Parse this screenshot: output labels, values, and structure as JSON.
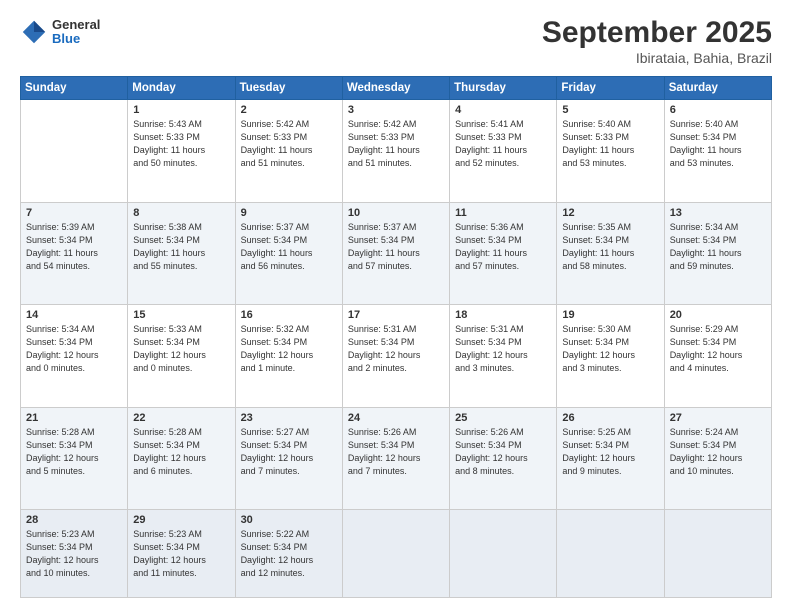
{
  "header": {
    "logo_line1": "General",
    "logo_line2": "Blue",
    "title": "September 2025",
    "subtitle": "Ibirataia, Bahia, Brazil"
  },
  "days_of_week": [
    "Sunday",
    "Monday",
    "Tuesday",
    "Wednesday",
    "Thursday",
    "Friday",
    "Saturday"
  ],
  "weeks": [
    [
      {
        "day": "",
        "info": ""
      },
      {
        "day": "1",
        "info": "Sunrise: 5:43 AM\nSunset: 5:33 PM\nDaylight: 11 hours\nand 50 minutes."
      },
      {
        "day": "2",
        "info": "Sunrise: 5:42 AM\nSunset: 5:33 PM\nDaylight: 11 hours\nand 51 minutes."
      },
      {
        "day": "3",
        "info": "Sunrise: 5:42 AM\nSunset: 5:33 PM\nDaylight: 11 hours\nand 51 minutes."
      },
      {
        "day": "4",
        "info": "Sunrise: 5:41 AM\nSunset: 5:33 PM\nDaylight: 11 hours\nand 52 minutes."
      },
      {
        "day": "5",
        "info": "Sunrise: 5:40 AM\nSunset: 5:33 PM\nDaylight: 11 hours\nand 53 minutes."
      },
      {
        "day": "6",
        "info": "Sunrise: 5:40 AM\nSunset: 5:34 PM\nDaylight: 11 hours\nand 53 minutes."
      }
    ],
    [
      {
        "day": "7",
        "info": "Sunrise: 5:39 AM\nSunset: 5:34 PM\nDaylight: 11 hours\nand 54 minutes."
      },
      {
        "day": "8",
        "info": "Sunrise: 5:38 AM\nSunset: 5:34 PM\nDaylight: 11 hours\nand 55 minutes."
      },
      {
        "day": "9",
        "info": "Sunrise: 5:37 AM\nSunset: 5:34 PM\nDaylight: 11 hours\nand 56 minutes."
      },
      {
        "day": "10",
        "info": "Sunrise: 5:37 AM\nSunset: 5:34 PM\nDaylight: 11 hours\nand 57 minutes."
      },
      {
        "day": "11",
        "info": "Sunrise: 5:36 AM\nSunset: 5:34 PM\nDaylight: 11 hours\nand 57 minutes."
      },
      {
        "day": "12",
        "info": "Sunrise: 5:35 AM\nSunset: 5:34 PM\nDaylight: 11 hours\nand 58 minutes."
      },
      {
        "day": "13",
        "info": "Sunrise: 5:34 AM\nSunset: 5:34 PM\nDaylight: 11 hours\nand 59 minutes."
      }
    ],
    [
      {
        "day": "14",
        "info": "Sunrise: 5:34 AM\nSunset: 5:34 PM\nDaylight: 12 hours\nand 0 minutes."
      },
      {
        "day": "15",
        "info": "Sunrise: 5:33 AM\nSunset: 5:34 PM\nDaylight: 12 hours\nand 0 minutes."
      },
      {
        "day": "16",
        "info": "Sunrise: 5:32 AM\nSunset: 5:34 PM\nDaylight: 12 hours\nand 1 minute."
      },
      {
        "day": "17",
        "info": "Sunrise: 5:31 AM\nSunset: 5:34 PM\nDaylight: 12 hours\nand 2 minutes."
      },
      {
        "day": "18",
        "info": "Sunrise: 5:31 AM\nSunset: 5:34 PM\nDaylight: 12 hours\nand 3 minutes."
      },
      {
        "day": "19",
        "info": "Sunrise: 5:30 AM\nSunset: 5:34 PM\nDaylight: 12 hours\nand 3 minutes."
      },
      {
        "day": "20",
        "info": "Sunrise: 5:29 AM\nSunset: 5:34 PM\nDaylight: 12 hours\nand 4 minutes."
      }
    ],
    [
      {
        "day": "21",
        "info": "Sunrise: 5:28 AM\nSunset: 5:34 PM\nDaylight: 12 hours\nand 5 minutes."
      },
      {
        "day": "22",
        "info": "Sunrise: 5:28 AM\nSunset: 5:34 PM\nDaylight: 12 hours\nand 6 minutes."
      },
      {
        "day": "23",
        "info": "Sunrise: 5:27 AM\nSunset: 5:34 PM\nDaylight: 12 hours\nand 7 minutes."
      },
      {
        "day": "24",
        "info": "Sunrise: 5:26 AM\nSunset: 5:34 PM\nDaylight: 12 hours\nand 7 minutes."
      },
      {
        "day": "25",
        "info": "Sunrise: 5:26 AM\nSunset: 5:34 PM\nDaylight: 12 hours\nand 8 minutes."
      },
      {
        "day": "26",
        "info": "Sunrise: 5:25 AM\nSunset: 5:34 PM\nDaylight: 12 hours\nand 9 minutes."
      },
      {
        "day": "27",
        "info": "Sunrise: 5:24 AM\nSunset: 5:34 PM\nDaylight: 12 hours\nand 10 minutes."
      }
    ],
    [
      {
        "day": "28",
        "info": "Sunrise: 5:23 AM\nSunset: 5:34 PM\nDaylight: 12 hours\nand 10 minutes."
      },
      {
        "day": "29",
        "info": "Sunrise: 5:23 AM\nSunset: 5:34 PM\nDaylight: 12 hours\nand 11 minutes."
      },
      {
        "day": "30",
        "info": "Sunrise: 5:22 AM\nSunset: 5:34 PM\nDaylight: 12 hours\nand 12 minutes."
      },
      {
        "day": "",
        "info": ""
      },
      {
        "day": "",
        "info": ""
      },
      {
        "day": "",
        "info": ""
      },
      {
        "day": "",
        "info": ""
      }
    ]
  ]
}
